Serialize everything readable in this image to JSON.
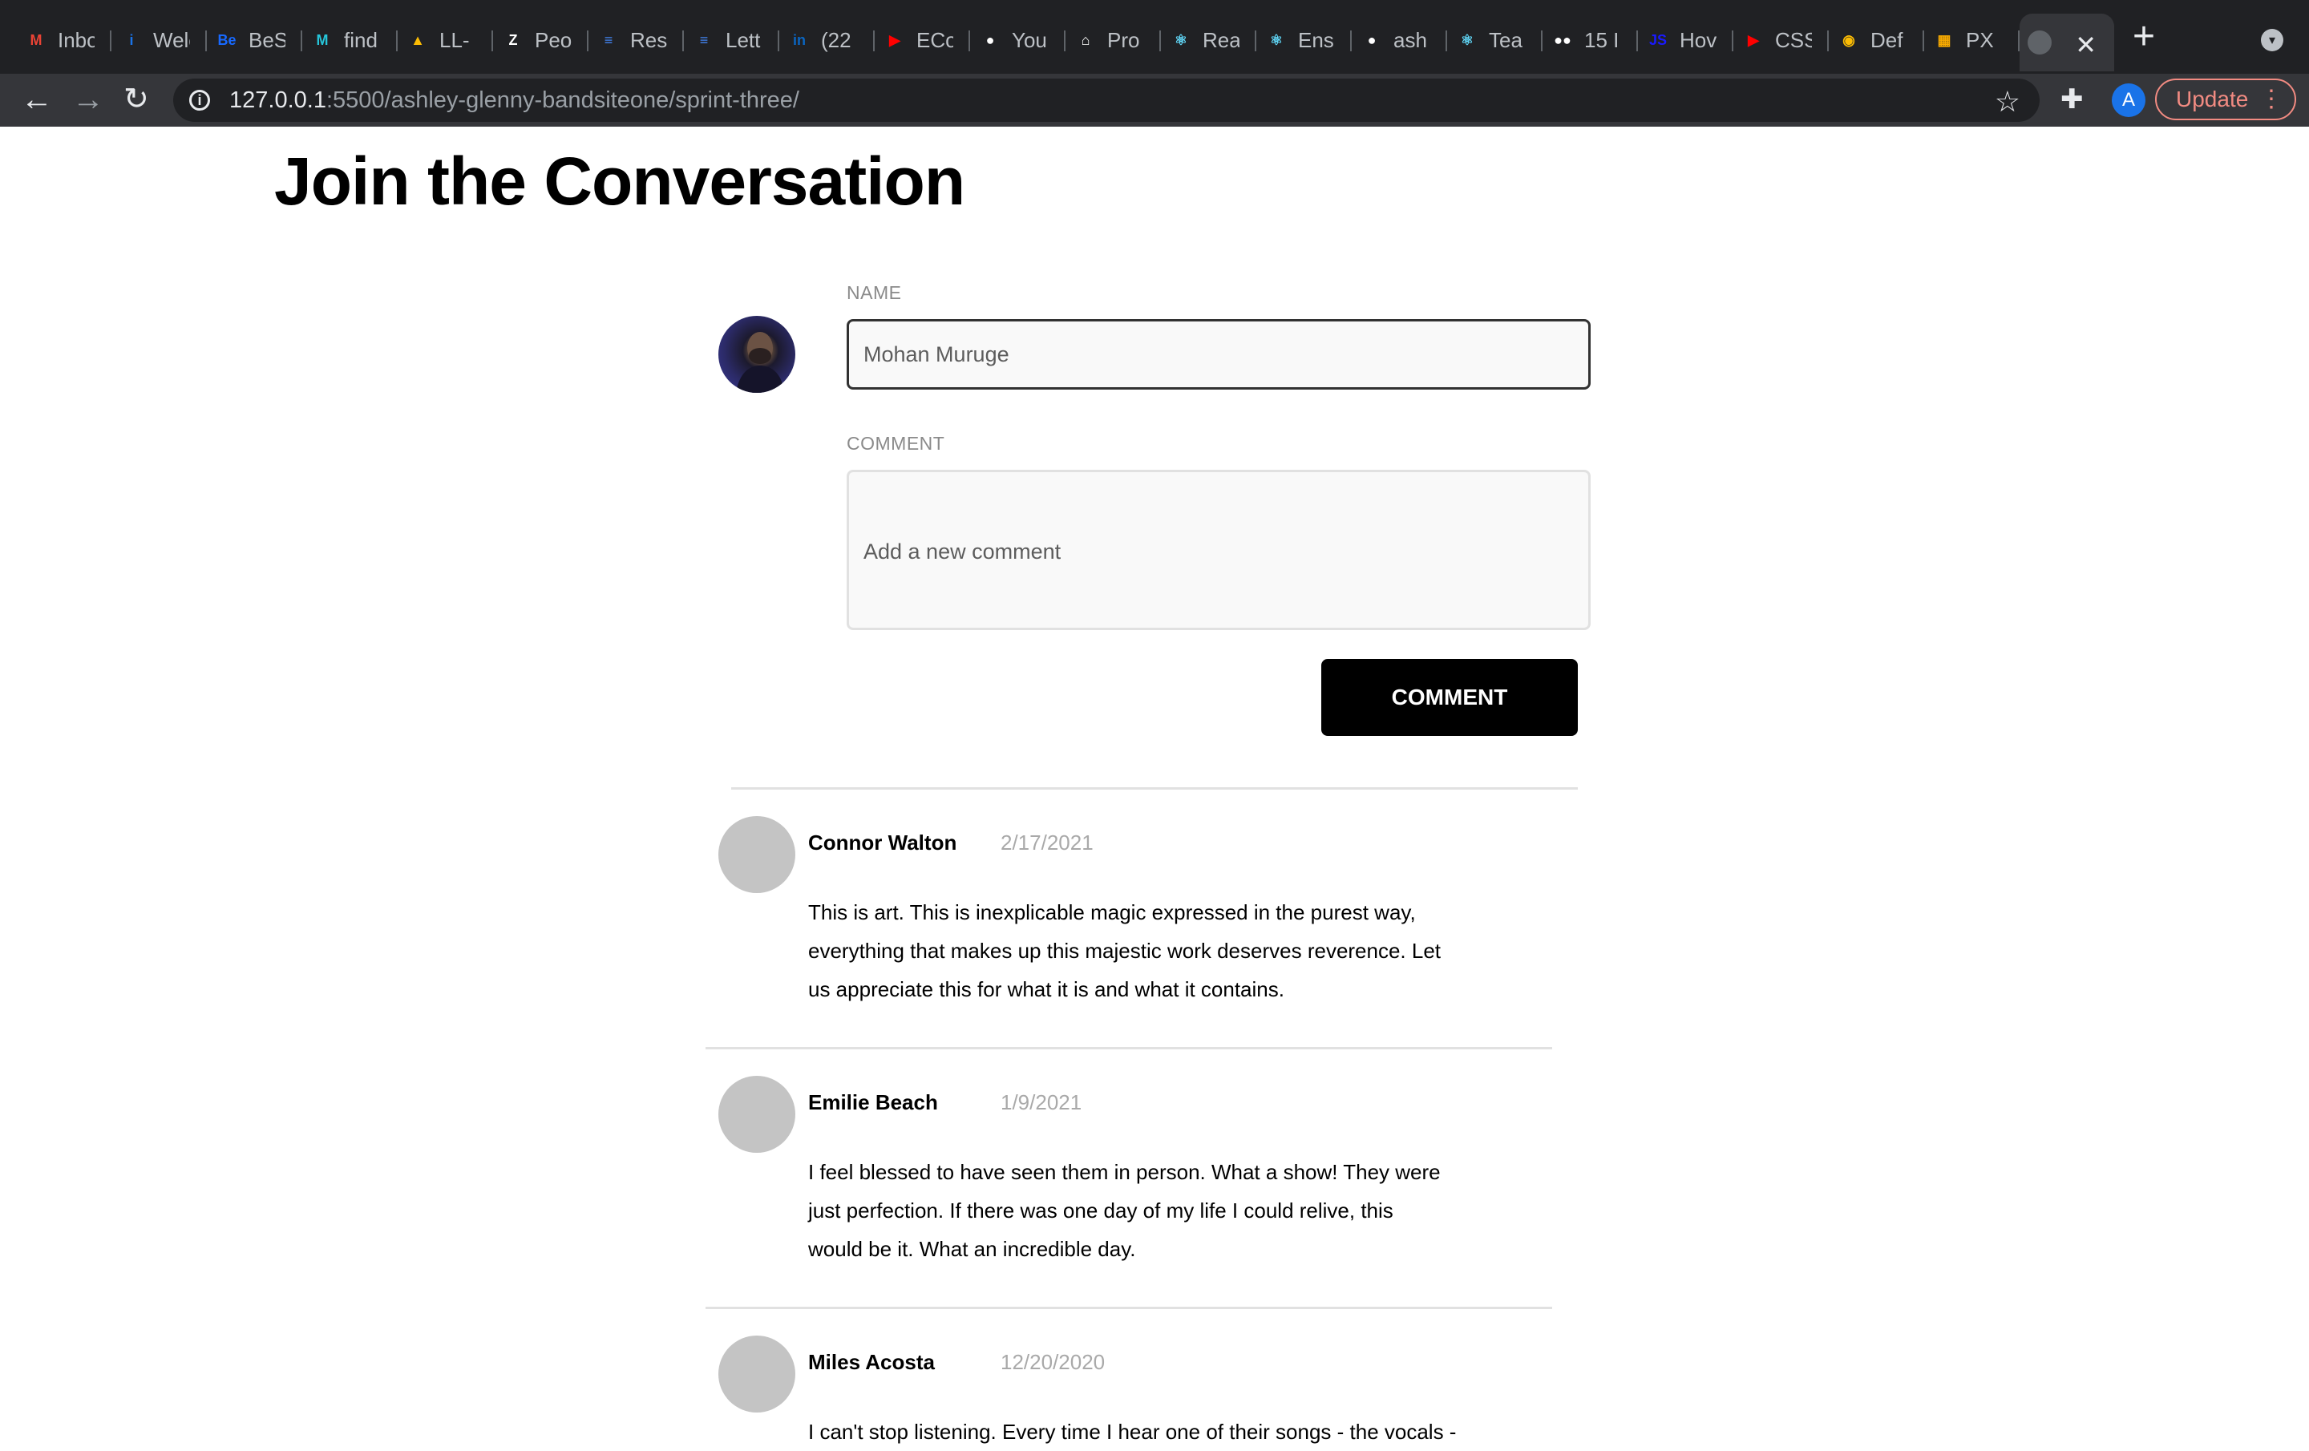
{
  "browser": {
    "tabs": [
      {
        "label": "Inbox",
        "icon": "gmail-icon",
        "color": "#ea4335",
        "glyph": "M"
      },
      {
        "label": "Welcome",
        "icon": "info-tab-icon",
        "color": "#1a73e8",
        "glyph": "i"
      },
      {
        "label": "BeS",
        "icon": "behance-icon",
        "color": "#1769ff",
        "glyph": "Be"
      },
      {
        "label": "find",
        "icon": "find-icon",
        "color": "#26c6da",
        "glyph": "M"
      },
      {
        "label": "LL-",
        "icon": "drive-icon",
        "color": "#fbbc04",
        "glyph": "▲"
      },
      {
        "label": "Peo",
        "icon": "zendesk-icon",
        "color": "#ffffff",
        "glyph": "Z"
      },
      {
        "label": "Res",
        "icon": "docs-icon",
        "color": "#4285f4",
        "glyph": "≡"
      },
      {
        "label": "Lett",
        "icon": "docs-icon",
        "color": "#4285f4",
        "glyph": "≡"
      },
      {
        "label": "(22",
        "icon": "linkedin-icon",
        "color": "#0a66c2",
        "glyph": "in"
      },
      {
        "label": "ECo",
        "icon": "youtube-icon",
        "color": "#ff0000",
        "glyph": "▶"
      },
      {
        "label": "You",
        "icon": "github-icon",
        "color": "#ffffff",
        "glyph": "●"
      },
      {
        "label": "Pro",
        "icon": "pro-icon",
        "color": "#ffffff",
        "glyph": "⌂"
      },
      {
        "label": "Rea",
        "icon": "react-icon",
        "color": "#61dafb",
        "glyph": "⚛"
      },
      {
        "label": "Ens",
        "icon": "react-icon",
        "color": "#61dafb",
        "glyph": "⚛"
      },
      {
        "label": "ash",
        "icon": "github-icon",
        "color": "#ffffff",
        "glyph": "●"
      },
      {
        "label": "Tea",
        "icon": "react-icon",
        "color": "#61dafb",
        "glyph": "⚛"
      },
      {
        "label": "15 I",
        "icon": "medium-icon",
        "color": "#ffffff",
        "glyph": "●●"
      },
      {
        "label": "Hov",
        "icon": "js-icon",
        "color": "#1a1aff",
        "glyph": "JS"
      },
      {
        "label": "CSS",
        "icon": "youtube-icon",
        "color": "#ff0000",
        "glyph": "▶"
      },
      {
        "label": "Def",
        "icon": "chrome-icon",
        "color": "#fbbc04",
        "glyph": "◉"
      },
      {
        "label": "PX",
        "icon": "calculator-icon",
        "color": "#f9ab00",
        "glyph": "▦"
      }
    ],
    "url_host": "127.0.0.1",
    "url_path": ":5500/ashley-glenny-bandsiteone/sprint-three/",
    "profile_initial": "A",
    "update_label": "Update"
  },
  "page": {
    "title": "Join the Conversation",
    "form": {
      "name_label": "NAME",
      "name_value": "Mohan Muruge",
      "comment_label": "COMMENT",
      "comment_placeholder": "Add a new comment",
      "submit_label": "COMMENT"
    },
    "comments": [
      {
        "name": "Connor Walton",
        "date": "2/17/2021",
        "text": "This is art. This is inexplicable magic expressed in the purest way, everything that makes up this majestic work deserves reverence. Let us appreciate this for what it is and what it contains."
      },
      {
        "name": "Emilie Beach",
        "date": "1/9/2021",
        "text": "I feel blessed to have seen them in person. What a show! They were just perfection. If there was one day of my life I could relive, this would be it. What an incredible day."
      },
      {
        "name": "Miles Acosta",
        "date": "12/20/2020",
        "text": "I can't stop listening. Every time I hear one of their songs - the vocals -"
      }
    ]
  }
}
